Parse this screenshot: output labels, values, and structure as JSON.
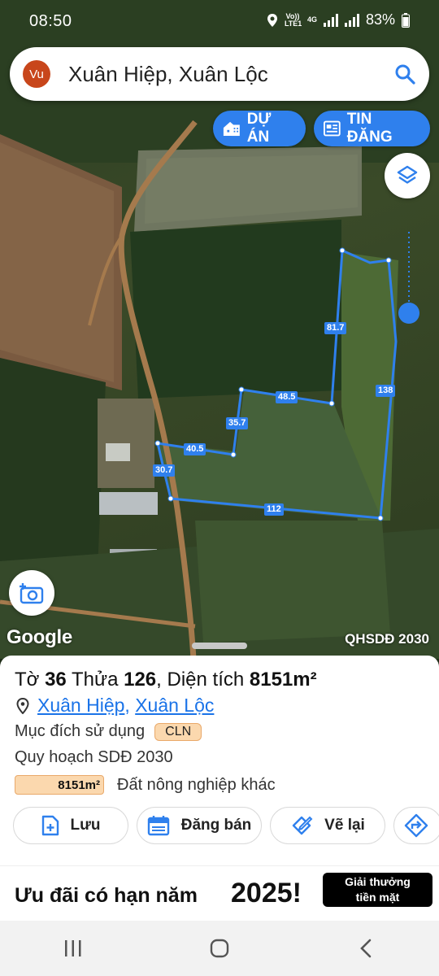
{
  "status_bar": {
    "time": "08:50",
    "volte_label": "Vo)) LTE1",
    "network_label": "4G",
    "battery": "83%"
  },
  "search": {
    "avatar_initials": "Vu",
    "query": "Xuân Hiệp, Xuân Lộc"
  },
  "chips": {
    "project_label": "DỰ ÁN",
    "news_label": "TIN ĐĂNG"
  },
  "map": {
    "attribution": "Google",
    "plan_layer": "QHSDĐ 2030",
    "parcel_edges": [
      "81.7",
      "138",
      "48.5",
      "35.7",
      "40.5",
      "30.7",
      "112"
    ],
    "parcel_color": "#2f80ed",
    "location_dot_color": "#2f80ed"
  },
  "parcel": {
    "title_prefix": "Tờ",
    "sheet_no": "36",
    "plot_prefix": "Thửa",
    "plot_no": "126",
    "area_prefix": "Diện tích",
    "area_value": "8151m²",
    "commune": "Xuân Hiệp",
    "district": "Xuân Lộc",
    "purpose_label": "Mục đích sử dụng",
    "purpose_code": "CLN",
    "plan_label": "Quy hoạch SDĐ 2030",
    "plan_area": "8151m²",
    "plan_use": "Đất nông nghiệp khác"
  },
  "actions": {
    "save": "Lưu",
    "sell": "Đăng bán",
    "redraw": "Vẽ lại"
  },
  "ad": {
    "text": "Ưu đãi có hạn năm",
    "year": "2025!",
    "button": "Giải thưởng tiền mặt"
  }
}
